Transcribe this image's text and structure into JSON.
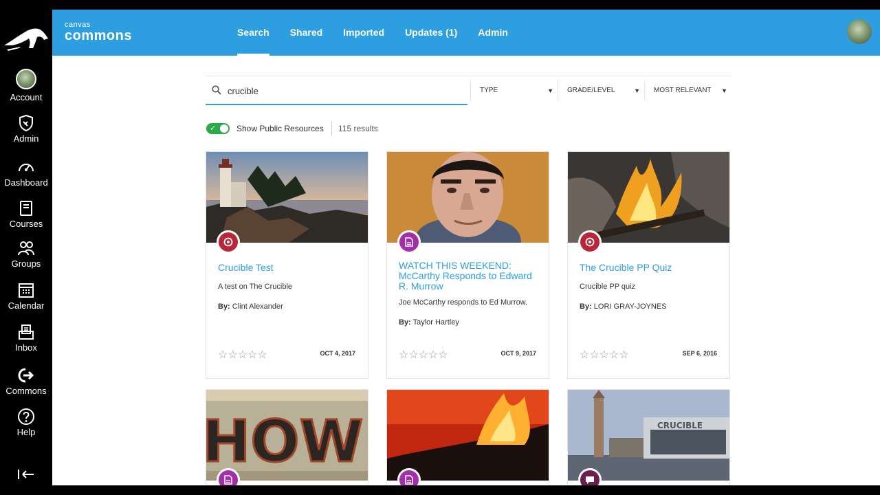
{
  "gnav": {
    "items": [
      {
        "label": "Account"
      },
      {
        "label": "Admin"
      },
      {
        "label": "Dashboard"
      },
      {
        "label": "Courses"
      },
      {
        "label": "Groups"
      },
      {
        "label": "Calendar"
      },
      {
        "label": "Inbox"
      },
      {
        "label": "Commons"
      },
      {
        "label": "Help"
      }
    ]
  },
  "header": {
    "brand_small": "canvas",
    "brand_big": "commons",
    "tabs": [
      {
        "label": "Search"
      },
      {
        "label": "Shared"
      },
      {
        "label": "Imported"
      },
      {
        "label": "Updates (1)"
      },
      {
        "label": "Admin"
      }
    ],
    "active_tab": "Search"
  },
  "search": {
    "value": "crucible",
    "filters": [
      "TYPE",
      "GRADE/LEVEL",
      "MOST RELEVANT"
    ]
  },
  "public_toggle": {
    "label": "Show Public Resources",
    "on": true,
    "results": "115 results"
  },
  "colors": {
    "brand_blue": "#2d9ee0",
    "toggle_green": "#2ca948",
    "quiz_badge": "#b9263a",
    "doc_badge": "#a32fa8",
    "discussion_badge": "#6a1f4e"
  },
  "cards": [
    {
      "title": "Crucible Test",
      "desc": "A test on The Crucible",
      "by_label": "By:",
      "author": "Clint Alexander",
      "date": "OCT 4, 2017",
      "badge_icon": "quiz-icon",
      "rating": 0
    },
    {
      "title": "WATCH THIS WEEKEND: McCarthy Responds to Edward R. Murrow",
      "desc": "Joe McCarthy responds to Ed Murrow.",
      "by_label": "By:",
      "author": "Taylor Hartley",
      "date": "OCT 9, 2017",
      "badge_icon": "document-icon",
      "rating": 0
    },
    {
      "title": "The Crucible PP Quiz",
      "desc": "Crucible PP quiz",
      "by_label": "By:",
      "author": "LORI GRAY-JOYNES",
      "date": "SEP 6, 2016",
      "badge_icon": "quiz-icon",
      "rating": 0
    },
    {
      "badge_icon": "document-icon",
      "thumb_text": "HOW"
    },
    {
      "badge_icon": "document-icon"
    },
    {
      "badge_icon": "discussion-icon",
      "thumb_text": "CRUCIBLE"
    }
  ]
}
